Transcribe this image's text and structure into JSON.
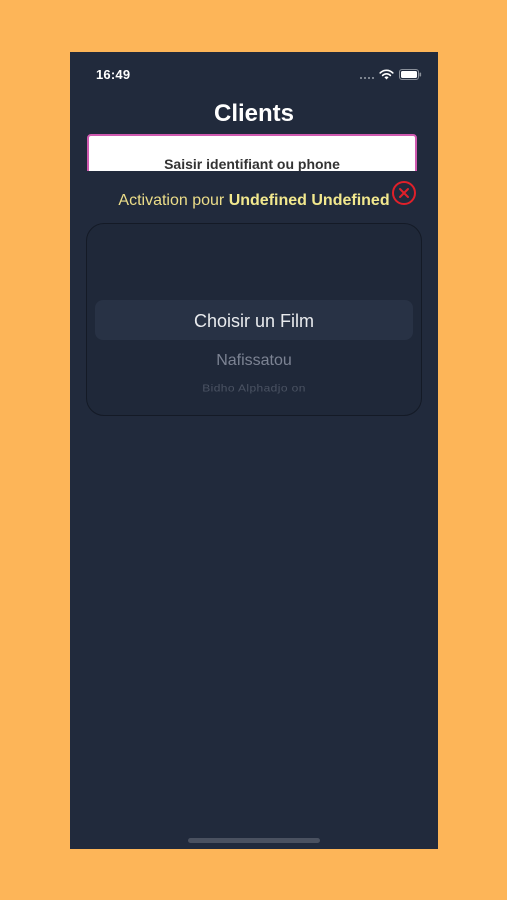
{
  "status_bar": {
    "time": "16:49",
    "icons": [
      "cellular-signal-icon",
      "wifi-icon",
      "battery-icon"
    ]
  },
  "header": {
    "title": "Clients"
  },
  "search": {
    "placeholder": "Saisir identifiant ou phone",
    "value": ""
  },
  "activation": {
    "prefix": "Activation pour",
    "name": "Undefined Undefined"
  },
  "close_button": {
    "icon": "close-circle-icon",
    "color": "#e0202a"
  },
  "picker": {
    "selected": "Choisir un Film",
    "options_below": [
      "Nafissatou",
      "Bidho Alphadjo on"
    ]
  },
  "colors": {
    "page_background": "#fdb558",
    "screen_background": "#212a3c",
    "search_border": "#d05ab0",
    "activation_text": "#ecdd89"
  }
}
